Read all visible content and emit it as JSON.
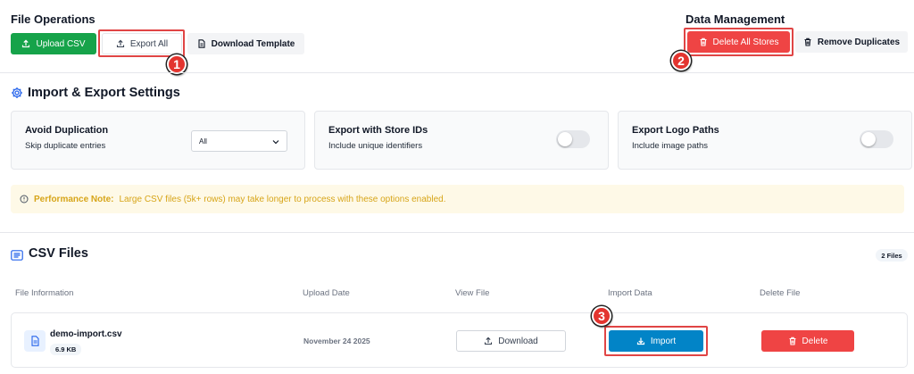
{
  "file_operations": {
    "title": "File Operations",
    "upload_label": "Upload CSV",
    "export_label": "Export All",
    "template_label": "Download Template"
  },
  "data_management": {
    "title": "Data Management",
    "delete_all_label": "Delete All Stores",
    "remove_dupes_label": "Remove Duplicates"
  },
  "annotations": [
    "1",
    "2",
    "3"
  ],
  "settings": {
    "title": "Import & Export Settings",
    "cards": [
      {
        "title": "Avoid Duplication",
        "subtitle": "Skip duplicate entries",
        "control": "select",
        "value": "All"
      },
      {
        "title": "Export with Store IDs",
        "subtitle": "Include unique identifiers",
        "control": "toggle",
        "enabled": false
      },
      {
        "title": "Export Logo Paths",
        "subtitle": "Include image paths",
        "control": "toggle",
        "enabled": false
      }
    ]
  },
  "note": {
    "label": "Performance Note:",
    "text": "Large CSV files (5k+ rows) may take longer to process with these options enabled."
  },
  "csv_files": {
    "title": "CSV Files",
    "count": "2 Files",
    "columns": [
      "File Information",
      "Upload Date",
      "View File",
      "Import Data",
      "Delete File"
    ],
    "rows": [
      {
        "name": "demo-import.csv",
        "size": "6.9 KB",
        "date": "November 24 2025",
        "download_label": "Download",
        "import_label": "Import",
        "delete_label": "Delete"
      }
    ]
  },
  "colors": {
    "primary_green": "#16a34a",
    "danger_red": "#ef4444",
    "import_blue": "#0284c7",
    "accent_blue": "#2563eb",
    "annotation_red": "#e3342f",
    "note_text": "#d7a519",
    "note_bg": "#fef9e7"
  }
}
